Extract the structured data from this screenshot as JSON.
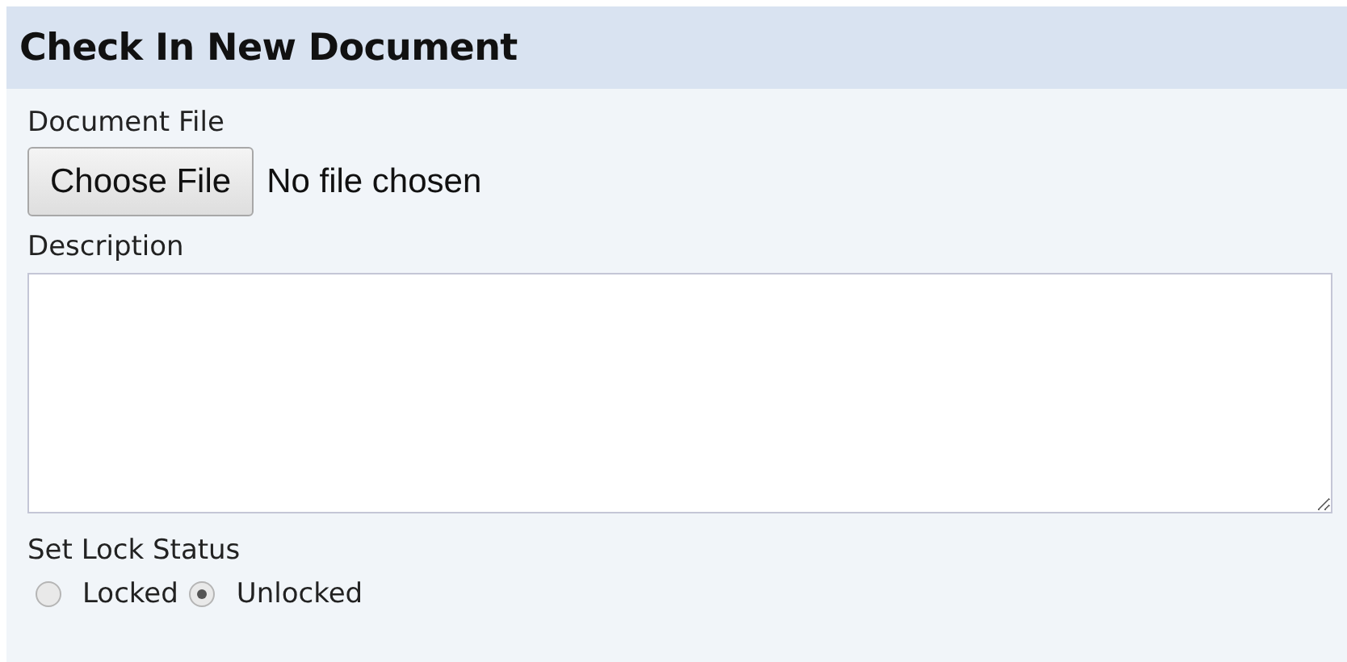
{
  "title": "Check In New Document",
  "file_field": {
    "label": "Document File",
    "button": "Choose File",
    "status": "No file chosen"
  },
  "description": {
    "label": "Description"
  },
  "lock_status": {
    "label": "Set Lock Status",
    "options": [
      {
        "label": "Locked",
        "selected": false
      },
      {
        "label": "Unlocked",
        "selected": true
      }
    ]
  }
}
